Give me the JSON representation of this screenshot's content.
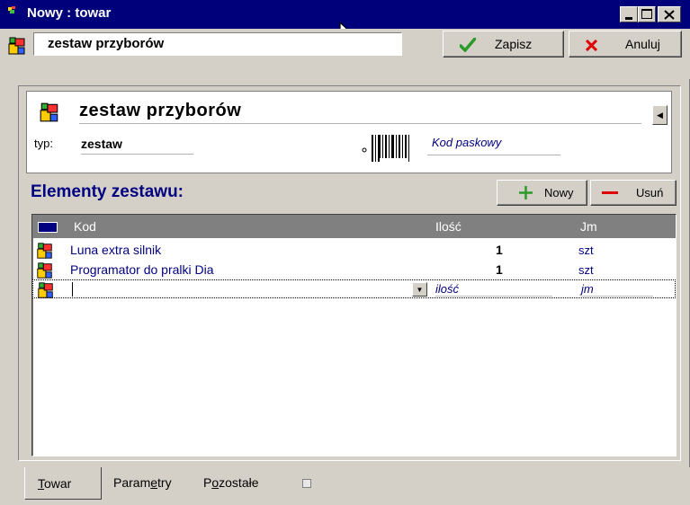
{
  "window": {
    "title": "Nowy : towar",
    "controls": [
      "minimize",
      "maximize",
      "close"
    ]
  },
  "toolbar": {
    "item_name": "zestaw przyborów",
    "save_label": "Zapisz",
    "cancel_label": "Anuluj"
  },
  "header": {
    "name": "zestaw przyborów",
    "type_label": "typ:",
    "type_value": "zestaw",
    "barcode_placeholder": "Kod paskowy"
  },
  "section": {
    "title": "Elementy zestawu:",
    "new_label": "Nowy",
    "delete_label": "Usuń"
  },
  "grid": {
    "columns": [
      "Kod",
      "Ilość",
      "Jm"
    ],
    "rows": [
      {
        "kod": "Luna extra silnik",
        "ilosc": "1",
        "jm": "szt"
      },
      {
        "kod": "Programator do pralki Dia",
        "ilosc": "1",
        "jm": "szt"
      }
    ],
    "new_row": {
      "ilosc_placeholder": "ilość",
      "jm_placeholder": "jm"
    }
  },
  "tabs": [
    {
      "label_first": "T",
      "label_rest": "owar",
      "active": true
    },
    {
      "label_pre": "Param",
      "label_u": "e",
      "label_post": "try",
      "active": false
    },
    {
      "label_pre": "P",
      "label_u": "o",
      "label_post": "zostałe",
      "active": false
    }
  ],
  "colors": {
    "titlebar": "#00007b",
    "accent_text": "#000080",
    "save_icon": "#2a9a2a",
    "cancel_icon": "#e00000",
    "grid_header": "#808080"
  },
  "icons": [
    "product-set-icon",
    "check-icon",
    "x-icon",
    "plus-icon",
    "minus-icon",
    "barcode-icon",
    "mouse-cursor-icon",
    "dropdown-arrow-icon"
  ]
}
